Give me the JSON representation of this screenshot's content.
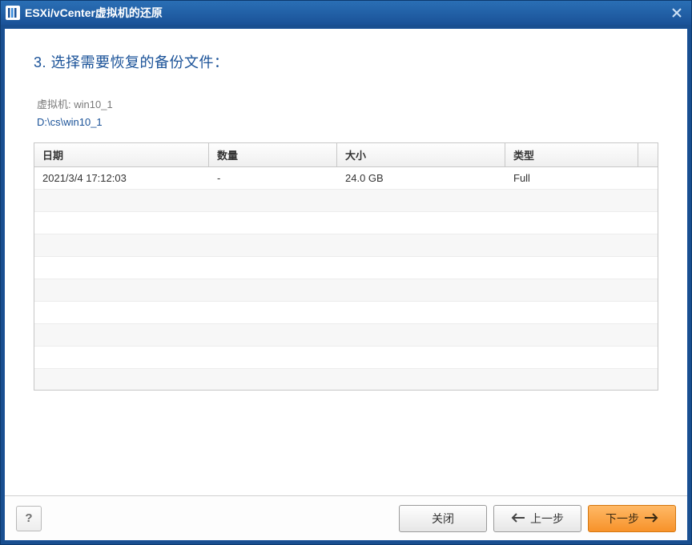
{
  "window": {
    "title": "ESXi/vCenter虚拟机的还原"
  },
  "step": {
    "heading": "3. 选择需要恢复的备份文件："
  },
  "vm": {
    "label": "虚拟机:",
    "name": "win10_1"
  },
  "path": {
    "value": "D:\\cs\\win10_1"
  },
  "table": {
    "columns": {
      "date": "日期",
      "qty": "数量",
      "size": "大小",
      "type": "类型"
    },
    "rows": [
      {
        "date": "2021/3/4 17:12:03",
        "qty": "-",
        "size": "24.0 GB",
        "type": "Full"
      }
    ],
    "empty_rows": 9
  },
  "footer": {
    "help": "?",
    "close": "关闭",
    "back": "上一步",
    "next": "下一步"
  }
}
